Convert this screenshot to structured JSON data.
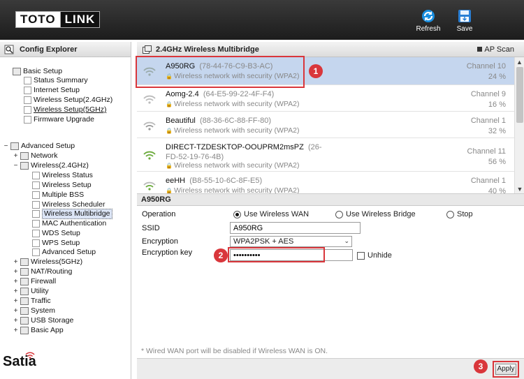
{
  "header": {
    "logo_left": "TOTO",
    "logo_right": "LINK",
    "refresh_label": "Refresh",
    "save_label": "Save",
    "refresh_icon": "refresh-icon",
    "save_icon": "save-icon"
  },
  "sidebar": {
    "title": "Config Explorer",
    "basic_setup": {
      "label": "Basic Setup",
      "items": [
        "Status Summary",
        "Internet Setup",
        "Wireless Setup(2.4GHz)",
        "Wireless Setup(5GHz)",
        "Firmware Upgrade"
      ]
    },
    "advanced_setup": {
      "label": "Advanced Setup",
      "network": "Network",
      "wireless24": {
        "label": "Wireless(2.4GHz)",
        "items": [
          "Wireless Status",
          "Wireless Setup",
          "Multiple BSS",
          "Wireless Scheduler",
          "Wireless Multibridge",
          "MAC Authentication",
          "WDS Setup",
          "WPS Setup",
          "Advanced Setup"
        ]
      },
      "groups": [
        "Wireless(5GHz)",
        "NAT/Routing",
        "Firewall",
        "Utility",
        "Traffic",
        "System",
        "USB Storage",
        "Basic App"
      ]
    }
  },
  "watermark": "Satia",
  "main": {
    "title": "2.4GHz Wireless Multibridge",
    "ap_scan_label": "AP Scan",
    "networks": [
      {
        "ssid": "A950RG",
        "mac": "(78-44-76-C9-B3-AC)",
        "mac2": "",
        "security": "Wireless network with security (WPA2)",
        "channel": "Channel 10",
        "signal": "24 %"
      },
      {
        "ssid": "Aomg-2.4",
        "mac": "(64-E5-99-22-4F-F4)",
        "mac2": "",
        "security": "Wireless network with security (WPA2)",
        "channel": "Channel 9",
        "signal": "16 %"
      },
      {
        "ssid": "Beautiful",
        "mac": "(88-36-6C-88-FF-80)",
        "mac2": "",
        "security": "Wireless network with security (WPA2)",
        "channel": "Channel 1",
        "signal": "32 %"
      },
      {
        "ssid": "DIRECT-TZDESKTOP-OOUPRM2msPZ",
        "mac": "(26-",
        "mac2": "FD-52-19-76-4B)",
        "security": "Wireless network with security (WPA2)",
        "channel": "Channel 11",
        "signal": "56 %"
      },
      {
        "ssid": "eeHH",
        "mac": "(B8-55-10-6C-8F-E5)",
        "mac2": "",
        "security": "Wireless network with security (WPA2)",
        "channel": "Channel 1",
        "signal": "40 %"
      }
    ],
    "form": {
      "section_title": "A950RG",
      "operation_label": "Operation",
      "op_wan": "Use Wireless WAN",
      "op_bridge": "Use Wireless Bridge",
      "op_stop": "Stop",
      "ssid_label": "SSID",
      "ssid_value": "A950RG",
      "encryption_label": "Encryption",
      "encryption_value": "WPA2PSK + AES",
      "key_label": "Encryption key",
      "key_value": "••••••••••",
      "unhide_label": "Unhide",
      "note": "* Wired WAN port will be disabled if Wireless WAN is ON.",
      "apply_label": "Apply"
    },
    "callouts": [
      "1",
      "2",
      "3"
    ]
  },
  "colors": {
    "header_bg": "#1c1c1c",
    "selected_row": "#c5d6ee",
    "callout_red": "#d9363b",
    "muted_text": "#888888"
  }
}
